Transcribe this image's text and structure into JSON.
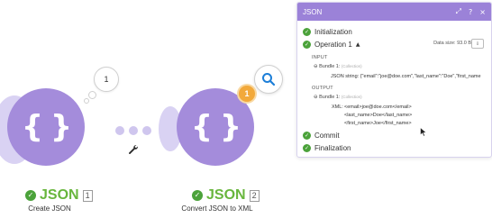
{
  "modules": [
    {
      "name": "JSON",
      "number": "1",
      "caption": "Create JSON",
      "glyph": "{ }"
    },
    {
      "name": "JSON",
      "number": "2",
      "caption": "Convert JSON to XML",
      "glyph": "{ }"
    }
  ],
  "bubble_count": "1",
  "badge_count": "1",
  "icons": {
    "search": "search-icon",
    "wrench": "wrench-icon",
    "expand": "expand-icon",
    "help": "help-icon",
    "close": "close-icon",
    "check": "check-icon"
  },
  "colors": {
    "module": "#a48cdb",
    "module_ring": "#d9d2f3",
    "header": "#9b82d8",
    "success": "#4ba23a",
    "name_green": "#68b63d",
    "badge": "#f2a93b"
  },
  "panel": {
    "title": "JSON",
    "header_icons": [
      "⤢",
      "?",
      "×"
    ],
    "initialization": "Initialization",
    "operation": "Operation 1",
    "data_size": "Data size: 93.0 B",
    "input_label": "INPUT",
    "input_bundle": "Bundle 1:",
    "input_bundle_type": "(Collection)",
    "json_string_label": "JSON string:",
    "json_string_value": "{\"email\":\"joe@doe.com\",\"last_name\":\"Doe\",\"first_name",
    "output_label": "OUTPUT",
    "output_bundle": "Bundle 1:",
    "output_bundle_type": "(Collection)",
    "xml_label": "XML:",
    "xml_lines": [
      "<email>joe@doe.com</email>",
      "<last_name>Doe</last_name>",
      "<first_name>Joe</first_name>"
    ],
    "commit": "Commit",
    "finalization": "Finalization"
  }
}
